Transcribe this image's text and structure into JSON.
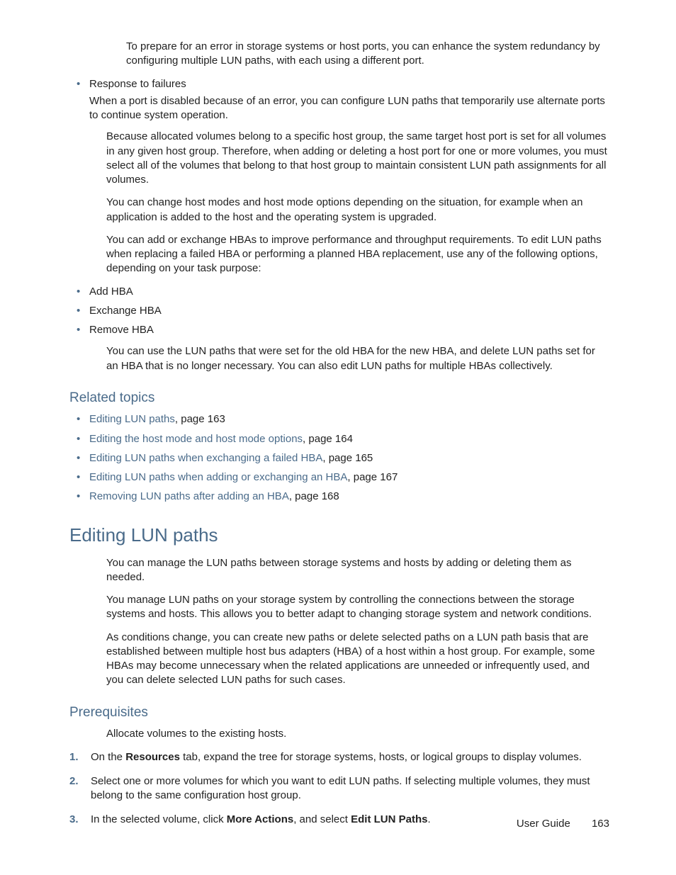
{
  "intro": {
    "para1": "To prepare for an error in storage systems or host ports, you can enhance the system redundancy by configuring multiple LUN paths, with each using a different port.",
    "bullet_head": "Response to failures",
    "bullet_body": "When a port is disabled because of an error, you can configure LUN paths that temporarily use alternate ports to continue system operation.",
    "para2": "Because allocated volumes belong to a specific host group, the same target host port is set for all volumes in any given host group. Therefore, when adding or deleting a host port for one or more volumes, you must select all of the volumes that belong to that host group to maintain consistent LUN path assignments for all volumes.",
    "para3": "You can change host modes and host mode options depending on the situation, for example when an application is added to the host and the operating system is upgraded.",
    "para4": "You can add or exchange HBAs to improve performance and throughput requirements. To edit LUN paths when replacing a failed HBA or performing a planned HBA replacement, use any of the following options, depending on your task purpose:",
    "hba_options": [
      "Add HBA",
      "Exchange HBA",
      "Remove HBA"
    ],
    "para5": "You can use the LUN paths that were set for the old HBA for the new HBA, and delete LUN paths set for an HBA that is no longer necessary. You can also edit LUN paths for multiple HBAs collectively."
  },
  "related": {
    "heading": "Related topics",
    "items": [
      {
        "link": "Editing LUN paths",
        "suffix": ", page 163"
      },
      {
        "link": "Editing the host mode and host mode options",
        "suffix": ", page 164"
      },
      {
        "link": "Editing LUN paths when exchanging a failed HBA",
        "suffix": ", page 165"
      },
      {
        "link": "Editing LUN paths when adding or exchanging an HBA",
        "suffix": ", page 167"
      },
      {
        "link": "Removing LUN paths after adding an HBA",
        "suffix": ", page 168"
      }
    ]
  },
  "editing": {
    "heading": "Editing LUN paths",
    "para1": "You can manage the LUN paths between storage systems and hosts by adding or deleting them as needed.",
    "para2": "You manage LUN paths on your storage system by controlling the connections between the storage systems and hosts. This allows you to better adapt to changing storage system and network conditions.",
    "para3": "As conditions change, you can create new paths or delete selected paths on a LUN path basis that are established between multiple host bus adapters (HBA) of a host within a host group. For example, some HBAs may become unnecessary when the related applications are unneeded or infrequently used, and you can delete selected LUN paths for such cases."
  },
  "prereq": {
    "heading": "Prerequisites",
    "para1": "Allocate volumes to the existing hosts.",
    "steps": [
      {
        "num": "1.",
        "before": "On the ",
        "bold1": "Resources",
        "after": " tab, expand the tree for storage systems, hosts, or logical groups to display volumes."
      },
      {
        "num": "2.",
        "text": "Select one or more volumes for which you want to edit LUN paths. If selecting multiple volumes, they must belong to the same configuration host group."
      },
      {
        "num": "3.",
        "before": "In the selected volume, click ",
        "bold1": "More Actions",
        "mid": ", and select ",
        "bold2": "Edit LUN Paths",
        "after": "."
      }
    ]
  },
  "footer": {
    "label": "User Guide",
    "page": "163"
  }
}
